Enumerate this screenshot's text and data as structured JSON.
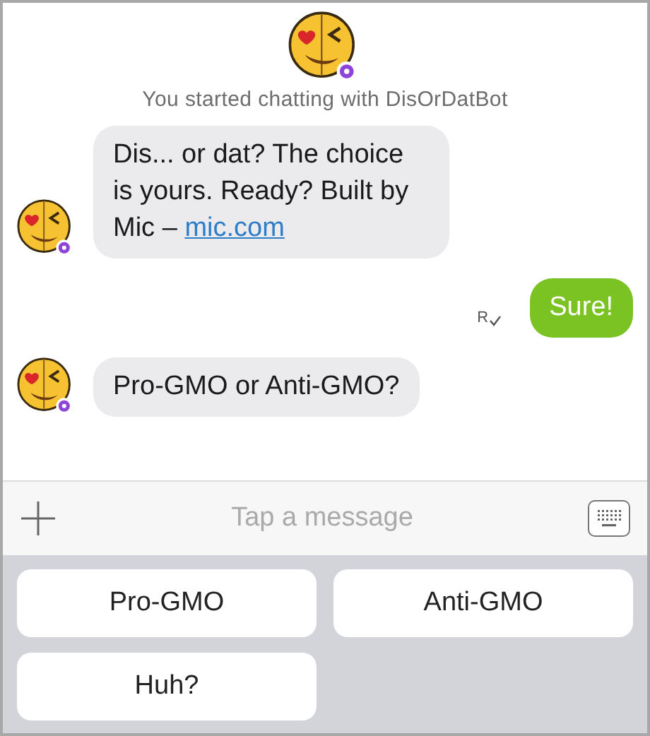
{
  "header": {
    "caption": "You started chatting with DisOrDatBot"
  },
  "messages": [
    {
      "kind": "incoming",
      "text": "Dis... or dat? The choice is yours. Ready? Built by Mic –",
      "link": "mic.com"
    },
    {
      "kind": "outgoing",
      "text": "Sure!",
      "receipt": "R"
    },
    {
      "kind": "incoming",
      "text": "Pro-GMO or Anti-GMO?"
    }
  ],
  "composer": {
    "placeholder": "Tap a message"
  },
  "quick_replies": [
    "Pro-GMO",
    "Anti-GMO",
    "Huh?"
  ]
}
